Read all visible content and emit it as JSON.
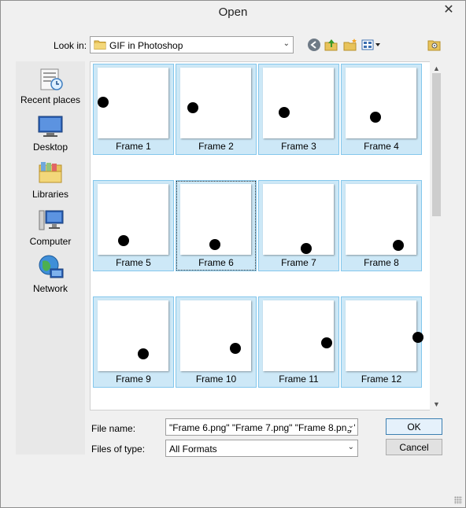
{
  "dialog": {
    "title": "Open",
    "close_glyph": "✕"
  },
  "lookin": {
    "label": "Look in:",
    "value": "GIF in Photoshop"
  },
  "toolbar": {
    "back_icon": "back-arrow-icon",
    "up_icon": "up-folder-icon",
    "new_folder_icon": "new-folder-icon",
    "views_icon": "view-menu-icon",
    "extra_icon": "folder-options-icon"
  },
  "places": [
    {
      "label": "Recent places",
      "icon": "recent-places-icon"
    },
    {
      "label": "Desktop",
      "icon": "desktop-icon"
    },
    {
      "label": "Libraries",
      "icon": "libraries-icon"
    },
    {
      "label": "Computer",
      "icon": "computer-icon"
    },
    {
      "label": "Network",
      "icon": "network-icon"
    }
  ],
  "files": [
    {
      "label": "Frame 1"
    },
    {
      "label": "Frame 2"
    },
    {
      "label": "Frame 3"
    },
    {
      "label": "Frame 4"
    },
    {
      "label": "Frame 5"
    },
    {
      "label": "Frame 6",
      "focused": true
    },
    {
      "label": "Frame 7"
    },
    {
      "label": "Frame 8"
    },
    {
      "label": "Frame 9"
    },
    {
      "label": "Frame 10"
    },
    {
      "label": "Frame 11"
    },
    {
      "label": "Frame 12"
    }
  ],
  "filename": {
    "label": "File name:",
    "value": "\"Frame 6.png\" \"Frame 7.png\" \"Frame 8.png\" \""
  },
  "filetype": {
    "label": "Files of type:",
    "value": "All Formats"
  },
  "buttons": {
    "ok": "OK",
    "cancel": "Cancel"
  },
  "colors": {
    "selection": "#cde8f7",
    "selection_border": "#84c7ec",
    "dot": "#000000"
  }
}
